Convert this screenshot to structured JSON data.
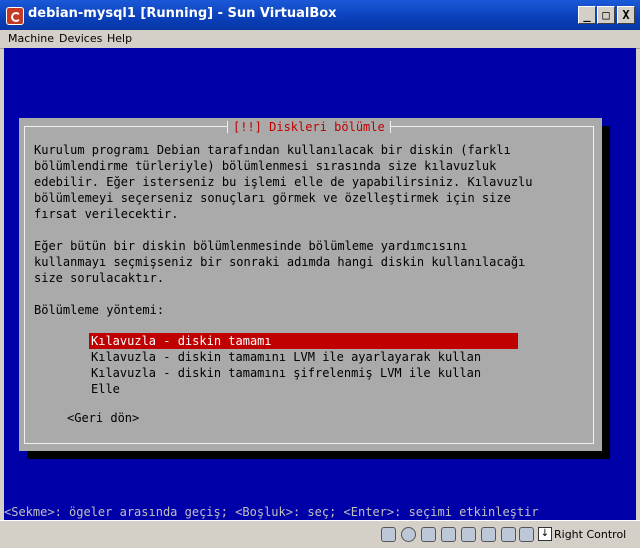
{
  "window": {
    "title": "debian-mysql1 [Running] - Sun VirtualBox",
    "min_glyph": "_",
    "max_glyph": "□",
    "close_glyph": "X"
  },
  "menu": {
    "items": [
      "Machine",
      "Devices",
      "Help"
    ]
  },
  "dialog": {
    "title": "[!!] Diskleri bölümle",
    "paragraph1": [
      "Kurulum programı Debian tarafından kullanılacak bir diskin (farklı",
      "bölümlendirme türleriyle) bölümlenmesi sırasında size kılavuzluk",
      "edebilir. Eğer isterseniz bu işlemi elle de yapabilirsiniz. Kılavuzlu",
      "bölümlemeyi seçerseniz sonuçları görmek ve özelleştirmek için size",
      "fırsat verilecektir."
    ],
    "paragraph2": [
      "Eğer bütün bir diskin bölümlenmesinde bölümleme yardımcısını",
      "kullanmayı seçmişseniz bir sonraki adımda hangi diskin kullanılacağı",
      "size sorulacaktır."
    ],
    "prompt": "Bölümleme yöntemi:",
    "options": [
      "Kılavuzla - diskin tamamı",
      "Kılavuzla - diskin tamamını LVM ile ayarlayarak kullan",
      "Kılavuzla - diskin tamamını şifrelenmiş LVM ile kullan",
      "Elle"
    ],
    "selected_index": 0,
    "back_button": "<Geri dön>"
  },
  "hint": "<Sekme>: ögeler arasında geçiş; <Boşluk>: seç; <Enter>: seçimi etkinleştir",
  "statusbar": {
    "icons": [
      "hard-disk-icon",
      "cd-drive-icon",
      "floppy-icon",
      "network-icon",
      "usb-icon",
      "shared-folder-icon",
      "display-icon",
      "virtualization-icon"
    ],
    "host_key_label": "Right Control"
  },
  "colors": {
    "console_bg": "#0000a8",
    "dialog_bg": "#aaaaaa",
    "title_red": "#c00000",
    "selection": "#c00000"
  }
}
